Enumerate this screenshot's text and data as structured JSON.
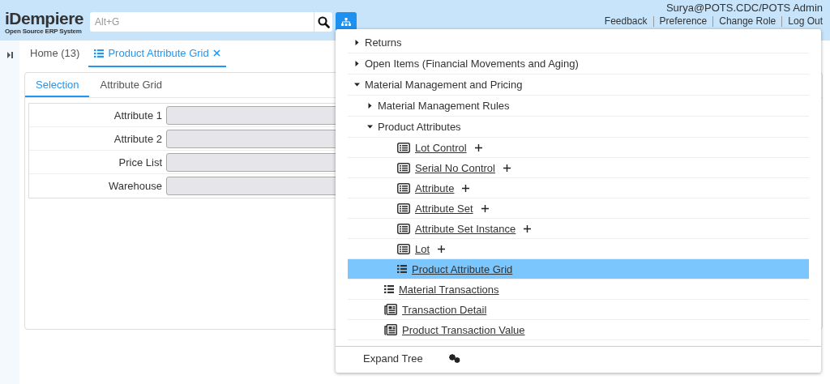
{
  "header": {
    "logo": {
      "name": "iDempiere",
      "tagline": "Open Source ERP System"
    },
    "search": {
      "placeholder": "Alt+G"
    },
    "user": "Surya@POTS.CDC/POTS Admin",
    "links": [
      "Feedback",
      "Preference",
      "Change Role",
      "Log Out"
    ]
  },
  "window_tabs": [
    {
      "label": "Home (13)",
      "selected": false,
      "closable": false
    },
    {
      "label": "Product Attribute Grid",
      "selected": true,
      "closable": true
    }
  ],
  "inner_tabs": [
    {
      "label": "Selection",
      "selected": true
    },
    {
      "label": "Attribute Grid",
      "selected": false
    }
  ],
  "fields": [
    {
      "label": "Attribute 1"
    },
    {
      "label": "Attribute 2"
    },
    {
      "label": "Price List"
    },
    {
      "label": "Warehouse"
    }
  ],
  "menu_tree": {
    "items": [
      {
        "label": "Returns",
        "kind": "folder",
        "expanded": false,
        "selected": false
      },
      {
        "label": "Open Items (Financial Movements and Aging)",
        "kind": "folder",
        "expanded": false,
        "selected": false
      },
      {
        "label": "Material Management and Pricing",
        "kind": "folder",
        "expanded": true,
        "selected": false,
        "children": [
          {
            "label": "Material Management Rules",
            "kind": "folder",
            "expanded": false,
            "selected": false
          },
          {
            "label": "Product Attributes",
            "kind": "folder",
            "expanded": true,
            "selected": false,
            "children": [
              {
                "label": "Lot Control",
                "kind": "window",
                "selected": false
              },
              {
                "label": "Serial No Control",
                "kind": "window",
                "selected": false
              },
              {
                "label": "Attribute",
                "kind": "window",
                "selected": false
              },
              {
                "label": "Attribute Set",
                "kind": "window",
                "selected": false
              },
              {
                "label": "Attribute Set Instance",
                "kind": "window",
                "selected": false
              },
              {
                "label": "Lot",
                "kind": "window",
                "selected": false
              },
              {
                "label": "Product Attribute Grid",
                "kind": "form",
                "selected": true
              }
            ]
          },
          {
            "label": "Material Transactions",
            "kind": "form",
            "selected": false
          },
          {
            "label": "Transaction Detail",
            "kind": "report",
            "selected": false
          },
          {
            "label": "Product Transaction Value",
            "kind": "report",
            "selected": false
          }
        ]
      }
    ],
    "footer": {
      "label": "Expand Tree"
    }
  }
}
